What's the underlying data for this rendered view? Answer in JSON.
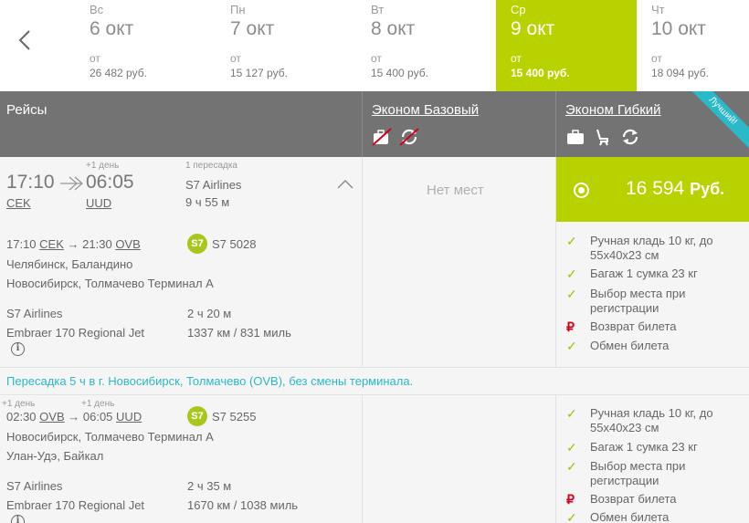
{
  "dates": [
    {
      "dow": "Вс",
      "date": "6 окт",
      "from": "от",
      "price": "26 482 руб.",
      "active": false
    },
    {
      "dow": "Пн",
      "date": "7 окт",
      "from": "от",
      "price": "15 127 руб.",
      "active": false
    },
    {
      "dow": "Вт",
      "date": "8 окт",
      "from": "от",
      "price": "15 400 руб.",
      "active": false
    },
    {
      "dow": "Ср",
      "date": "9 окт",
      "from": "от",
      "price": "15 400 руб.",
      "active": true
    },
    {
      "dow": "Чт",
      "date": "10 окт",
      "from": "от",
      "price": "18 094 руб.",
      "active": false
    }
  ],
  "header": {
    "flights": "Рейсы",
    "fare1": "Эконом Базовый",
    "fare2": "Эконом Гибкий",
    "ribbon": "Лучший!"
  },
  "summary": {
    "dep_time": "17:10",
    "arr_time": "06:05",
    "next_day": "+1 день",
    "dep_code": "CEK",
    "arr_code": "UUD",
    "stops": "1 пересадка",
    "airline": "S7 Airlines",
    "duration": "9 ч 55 м"
  },
  "fare1": {
    "no_seats": "Нет мест"
  },
  "fare2": {
    "price": "16 594",
    "currency": "Руб."
  },
  "segment1": {
    "dep_time": "17:10",
    "dep_code": "CEK",
    "arr_time": "21:30",
    "arr_code": "OVB",
    "flight_no": "S7 5028",
    "airline_logo": "S7",
    "from_airport": "Челябинск, Баландино",
    "to_airport": "Новосибирск, Толмачево Терминал А",
    "carrier": "S7 Airlines",
    "aircraft": "Embraer 170 Regional Jet",
    "duration": "2 ч 20 м",
    "distance": "1337 км / 831 миль"
  },
  "transfer": "Пересадка 5 ч в г. Новосибирск, Толмачево (OVB), без смены терминала.",
  "segment2": {
    "dep_next_day": "+1 день",
    "arr_next_day": "+1 день",
    "dep_time": "02:30",
    "dep_code": "OVB",
    "arr_time": "06:05",
    "arr_code": "UUD",
    "flight_no": "S7 5255",
    "airline_logo": "S7",
    "from_airport": "Новосибирск, Толмачево Терминал А",
    "to_airport": "Улан-Удэ, Байкал",
    "carrier": "S7 Airlines",
    "aircraft": "Embraer 170 Regional Jet",
    "duration": "2 ч 35 м",
    "distance": "1670 км / 1038 миль"
  },
  "features1": [
    {
      "icon": "check-icon",
      "text": "Ручная кладь 10 кг, до 55х40х23 см"
    },
    {
      "icon": "check-icon",
      "text": "Багаж 1 сумка 23 кг"
    },
    {
      "icon": "check-icon",
      "text": "Выбор места при регистрации"
    },
    {
      "icon": "ruble-icon",
      "text": "Возврат билета"
    },
    {
      "icon": "check-icon",
      "text": "Обмен билета"
    }
  ],
  "features2": [
    {
      "icon": "check-icon",
      "text": "Ручная кладь 10 кг, до 55х40х23 см"
    },
    {
      "icon": "check-icon",
      "text": "Багаж 1 сумка 23 кг"
    },
    {
      "icon": "check-icon",
      "text": "Выбор места при регистрации"
    },
    {
      "icon": "ruble-icon",
      "text": "Возврат билета"
    },
    {
      "icon": "check-icon",
      "text": "Обмен билета"
    }
  ],
  "colors": {
    "accent": "#b8d200",
    "header": "#737373",
    "link": "#2ab9c8",
    "ruble": "#d0021b"
  }
}
